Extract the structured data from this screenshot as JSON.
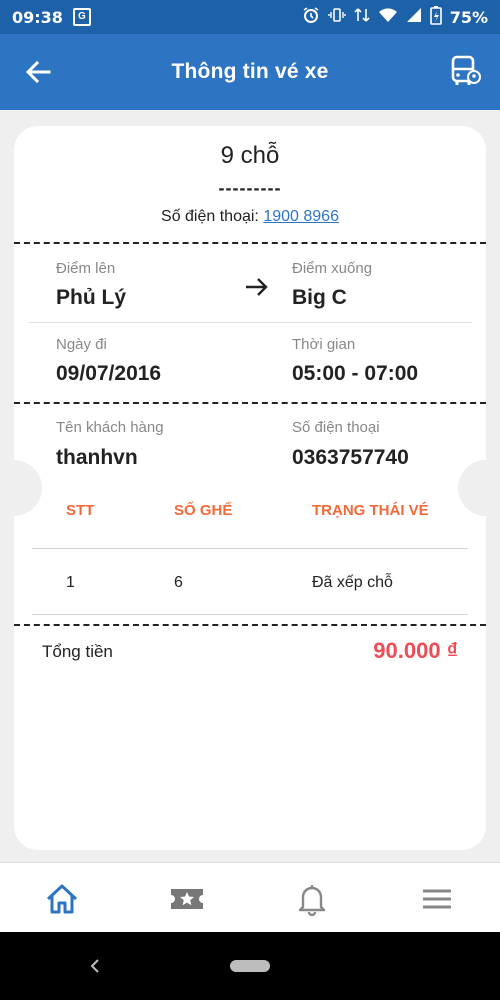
{
  "status_bar": {
    "time": "09:38",
    "battery": "75%",
    "icons": [
      "google-translate-icon",
      "alarm-icon",
      "vibrate-icon",
      "cellular-data-icon",
      "wifi-icon",
      "signal-icon",
      "battery-icon"
    ]
  },
  "header": {
    "title": "Thông tin vé xe",
    "back_icon": "arrow-left-icon",
    "action_icon": "bus-location-icon"
  },
  "ticket": {
    "vehicle_type": "9 chỗ",
    "plate": "---------",
    "phone_label": "Số điện thoại:",
    "phone_value": "1900 8966",
    "pickup_label": "Điểm lên",
    "pickup_value": "Phủ Lý",
    "dropoff_label": "Điểm xuống",
    "dropoff_value": "Big C",
    "date_label": "Ngày đi",
    "date_value": "09/07/2016",
    "time_label": "Thời gian",
    "time_value": "05:00 - 07:00",
    "customer_label": "Tên khách hàng",
    "customer_value": "thanhvn",
    "customer_phone_label": "Số điện thoại",
    "customer_phone_value": "0363757740",
    "table": {
      "headers": [
        "STT",
        "SỐ GHẾ",
        "TRẠNG THÁI VÉ"
      ],
      "rows": [
        [
          "1",
          "6",
          "Đã xếp chỗ"
        ]
      ]
    },
    "total_label": "Tổng tiền",
    "total_value": "90.000 ₫"
  },
  "colors": {
    "primary": "#2d74c3",
    "status_bar": "#1d61a8",
    "accent_orange": "#f26a3a",
    "price_red": "#ee4c56"
  },
  "bottom_nav": [
    "home-icon",
    "ticket-star-icon",
    "bell-icon",
    "menu-icon"
  ]
}
